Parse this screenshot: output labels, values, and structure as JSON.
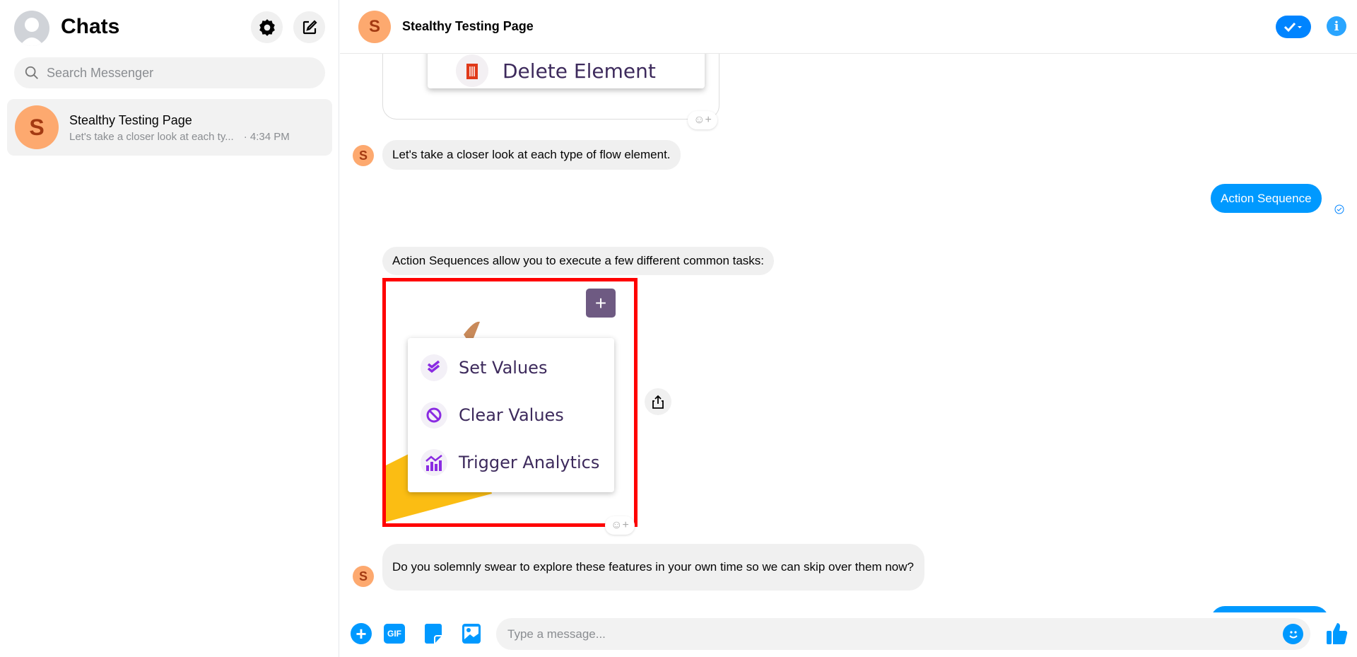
{
  "sidebar": {
    "title": "Chats",
    "search_placeholder": "Search Messenger",
    "chats": [
      {
        "initial": "S",
        "name": "Stealthy Testing Page",
        "preview": "Let's take a closer look at each ty...",
        "time": "· 4:34 PM"
      }
    ]
  },
  "header": {
    "initial": "S",
    "title": "Stealthy Testing Page"
  },
  "messages": {
    "card_top_label": "Delete Element",
    "m1": "Let's take a closer look at each type of flow element.",
    "sent1": "Action Sequence",
    "m2": "Action Sequences allow you to execute a few different common tasks:",
    "menu_items": [
      "Set Values",
      "Clear Values",
      "Trigger Analytics"
    ],
    "m3": "Do you solemnly swear to explore these features in your own time so we can skip over them now?",
    "avatar_initial": "S"
  },
  "composer": {
    "placeholder": "Type a message..."
  },
  "colors": {
    "accent": "#0084ff",
    "highlight": "#ff0000",
    "avatar": "#fda96f",
    "menu_icon": "#8a2be2"
  }
}
